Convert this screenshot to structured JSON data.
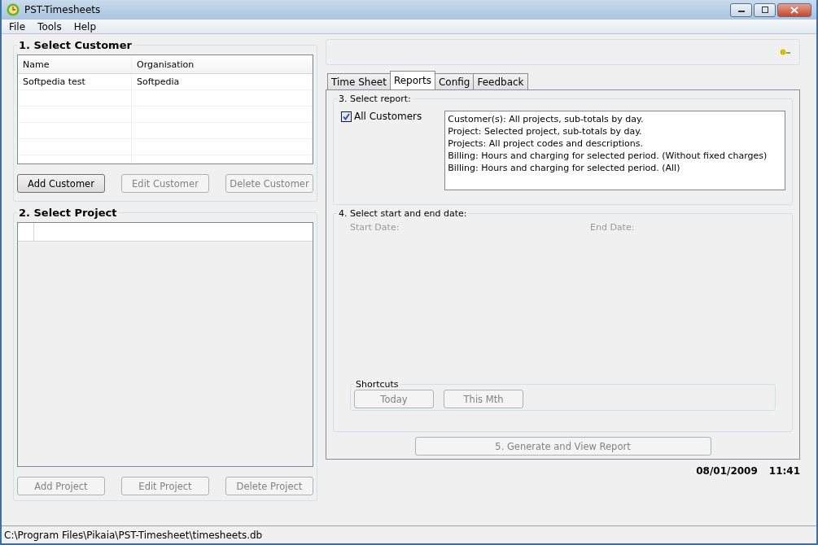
{
  "window": {
    "title": "PST-Timesheets"
  },
  "menu": [
    "File",
    "Tools",
    "Help"
  ],
  "customer_group": {
    "title": "1. Select Customer",
    "columns": [
      "Name",
      "Organisation"
    ],
    "rows": [
      {
        "cells": [
          "Softpedia test",
          "Softpedia"
        ],
        "selected": false
      }
    ],
    "buttons": [
      {
        "label": "Add Customer",
        "disabled": false
      },
      {
        "label": "Edit Customer",
        "disabled": true
      },
      {
        "label": "Delete Customer",
        "disabled": true
      }
    ]
  },
  "project_group": {
    "title": "2. Select Project",
    "buttons": [
      {
        "label": "Add Project",
        "disabled": true
      },
      {
        "label": "Edit Project",
        "disabled": true
      },
      {
        "label": "Delete Project",
        "disabled": true
      }
    ]
  },
  "tabs": [
    {
      "label": "Time Sheet",
      "selected": false
    },
    {
      "label": "Reports",
      "selected": true
    },
    {
      "label": "Config",
      "selected": false
    },
    {
      "label": "Feedback",
      "selected": false
    }
  ],
  "report_group": {
    "title": "3. Select report:",
    "all_customers": {
      "label": "All Customers",
      "checked": true
    },
    "reports": [
      {
        "label": "Customer(s): All projects, sub-totals by day.",
        "selected": false
      },
      {
        "label": "Project: Selected project, sub-totals by day.",
        "selected": false
      },
      {
        "label": "Projects: All project codes and descriptions.",
        "selected": false
      },
      {
        "label": "Billing: Hours and charging for selected period. (Without fixed charges)",
        "selected": false
      },
      {
        "label": "Billing: Hours and charging for selected period. (All)",
        "selected": false
      }
    ]
  },
  "date_group": {
    "title": "4. Select start and end date:",
    "start_label": "Start Date:",
    "end_label": "End Date:",
    "shortcuts": {
      "title": "Shortcuts",
      "buttons": [
        {
          "label": "Today",
          "disabled": true
        },
        {
          "label": "This Mth",
          "disabled": true
        }
      ]
    }
  },
  "generate_button": {
    "label": "5. Generate and View Report",
    "disabled": true
  },
  "datetime": {
    "date": "08/01/2009",
    "time": "11:41"
  },
  "status_bar": "C:\\Program Files\\Pikaia\\PST-Timesheet\\timesheets.db"
}
